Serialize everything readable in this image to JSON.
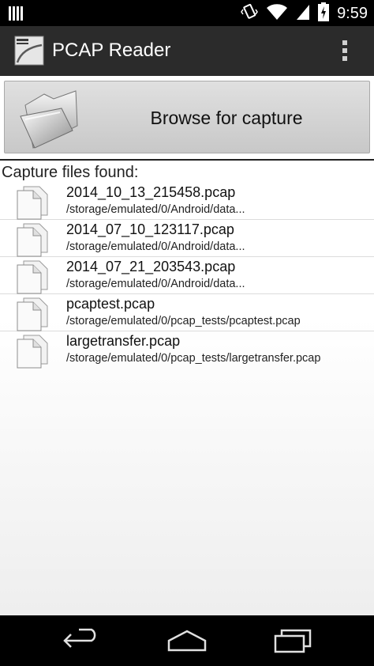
{
  "status_bar": {
    "time": "9:59",
    "icons": [
      "notification-icon",
      "vibrate-icon",
      "wifi-icon",
      "signal-icon",
      "battery-icon"
    ]
  },
  "action_bar": {
    "title": "PCAP Reader",
    "icon": "pcap-app-icon",
    "menu_icon": "overflow-menu-icon"
  },
  "browse": {
    "label": "Browse for capture",
    "icon": "folder-icon"
  },
  "files_section": {
    "label": "Capture files found:",
    "files": [
      {
        "name": "2014_10_13_215458.pcap",
        "path": "/storage/emulated/0/Android/data..."
      },
      {
        "name": "2014_07_10_123117.pcap",
        "path": "/storage/emulated/0/Android/data..."
      },
      {
        "name": "2014_07_21_203543.pcap",
        "path": "/storage/emulated/0/Android/data..."
      },
      {
        "name": "pcaptest.pcap",
        "path": "/storage/emulated/0/pcap_tests/pcaptest.pcap"
      },
      {
        "name": "largetransfer.pcap",
        "path": "/storage/emulated/0/pcap_tests/largetransfer.pcap"
      }
    ]
  },
  "nav_bar": {
    "buttons": [
      "back-icon",
      "home-icon",
      "recent-apps-icon"
    ]
  },
  "colors": {
    "status_bar": "#000000",
    "action_bar": "#2b2b2b",
    "button_face": "#d4d4d4",
    "nav_bar": "#000000"
  }
}
